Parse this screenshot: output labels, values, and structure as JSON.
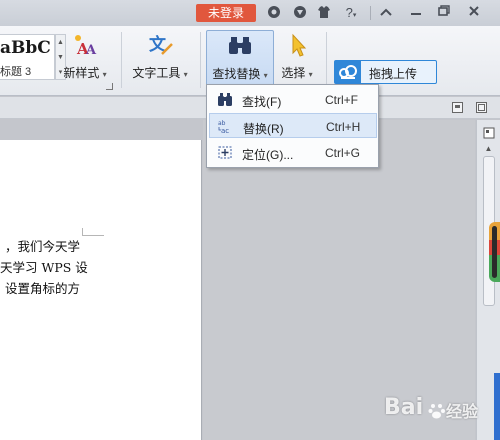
{
  "titlebar": {
    "login_label": "未登录",
    "help_label": "?",
    "icons": [
      "skin-icon",
      "feedback-icon",
      "shirt-icon",
      "help-icon",
      "collapse-ribbon-icon",
      "minimize-icon",
      "restore-icon",
      "close-icon"
    ]
  },
  "ribbon": {
    "style_sample": "aBbC",
    "style_name": "标题 3",
    "new_style_label": "新样式",
    "text_tools_label": "文字工具",
    "find_replace_label": "查找替换",
    "select_label": "选择",
    "upload_label": "拖拽上传",
    "caret": "▾"
  },
  "menu": {
    "items": [
      {
        "label": "查找(F)",
        "shortcut": "Ctrl+F",
        "icon": "binoculars-icon"
      },
      {
        "label": "替换(R)",
        "shortcut": "Ctrl+H",
        "icon": "replace-icon"
      },
      {
        "label": "定位(G)...",
        "shortcut": "Ctrl+G",
        "icon": "goto-icon"
      }
    ]
  },
  "document": {
    "lines": [
      "，我们今天学",
      "天学习 WPS 设",
      "设置角标的方"
    ]
  },
  "watermark": {
    "brand": "Bai",
    "suffix": "经验"
  },
  "colors": {
    "login": "#e1573d",
    "upload_border": "#2f87d8",
    "menu_highlight": "#dde9f8"
  }
}
